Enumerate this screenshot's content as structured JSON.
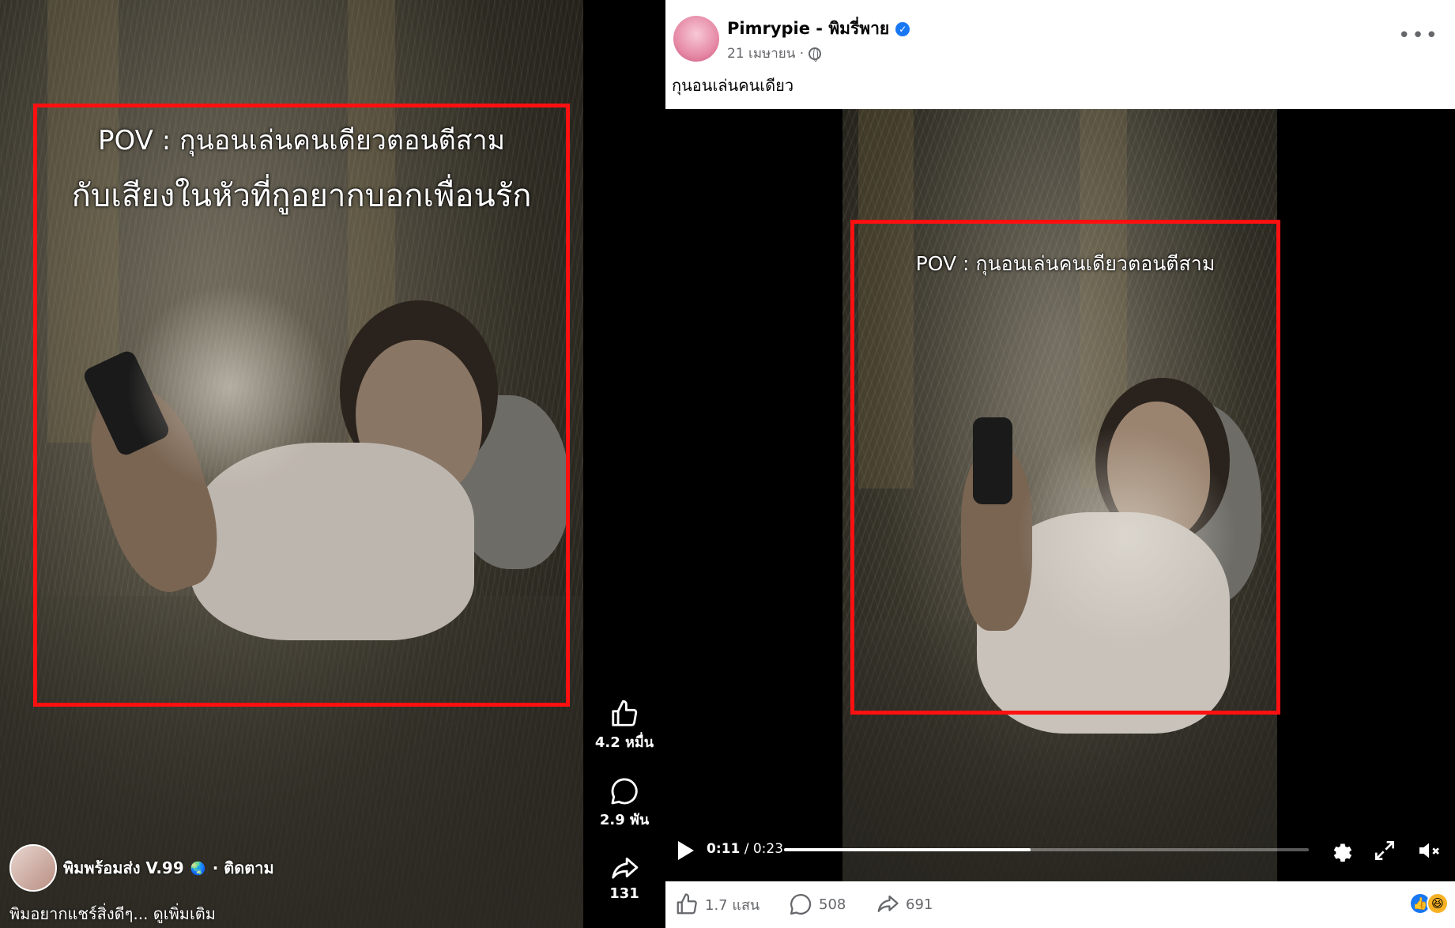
{
  "reel": {
    "overlay_line1": "POV : กุนอนเล่นคนเดียวตอนตีสาม",
    "overlay_line2": "กับเสียงในหัวที่กูอยากบอกเพื่อนรัก",
    "author": "พิมพร้อมส่ง V.99",
    "follow_label": "· ติดตาม",
    "description": "พิมอยากแชร์สิ่งดีๆ... ดูเพิ่มเติม"
  },
  "rail": {
    "likes": "4.2 หมื่น",
    "comments": "2.9 พัน",
    "shares": "131"
  },
  "post": {
    "author": "Pimrypie - พิมรี่พาย",
    "date": "21 เมษายน ·",
    "text": "กุนอนเล่นคนเดียว",
    "video_overlay": "POV : กุนอนเล่นคนเดียวตอนตีสาม",
    "time_current": "0:11",
    "time_total": " / 0:23",
    "progress": 0.47,
    "likes": "1.7 แสน",
    "comments": "508",
    "shares": "691"
  },
  "colors": {
    "highlight_box": "#ff1010",
    "facebook_blue": "#1877f2",
    "secondary_text": "#65676b"
  },
  "icons": [
    "like-icon",
    "comment-icon",
    "share-icon",
    "play-icon",
    "settings-icon",
    "fullscreen-icon",
    "mute-icon",
    "globe-icon",
    "verified-icon",
    "more-icon"
  ]
}
